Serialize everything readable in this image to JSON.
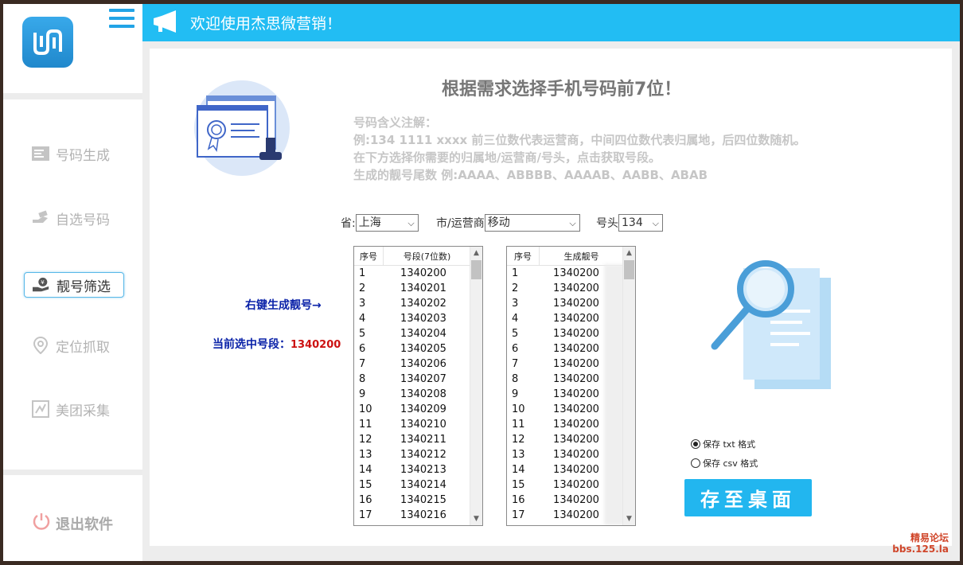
{
  "header": {
    "title": "欢迎使用杰思微营销！"
  },
  "sidebar": {
    "items": [
      {
        "label": "号码生成",
        "icon": "list-icon"
      },
      {
        "label": "自选号码",
        "icon": "hand-icon"
      },
      {
        "label": "靓号筛选",
        "icon": "money-hand-icon"
      },
      {
        "label": "定位抓取",
        "icon": "location-pin-icon"
      },
      {
        "label": "美团采集",
        "icon": "collect-icon"
      }
    ],
    "active_index": 2,
    "exit_label": "退出软件"
  },
  "main": {
    "heading": "根据需求选择手机号码前7位！",
    "notes": [
      "号码含义注解：",
      "例:134 1111 xxxx  前三位数代表运营商，中间四位数代表归属地，后四位数随机。",
      "在下方选择你需要的归属地/运营商/号头，点击获取号段。",
      "生成的靓号尾数 例:AAAA、ABBBB、AAAAB、AABB、ABAB"
    ],
    "filters": {
      "province_label": "省:",
      "province_value": "上海",
      "city_label": "市/运营商",
      "city_value": "移动",
      "prefix_label": "号头",
      "prefix_value": "134"
    },
    "hint_label": "右键生成靓号→",
    "current_label": "当前选中号段：",
    "current_value": "1340200",
    "segment_table": {
      "headers": [
        "序号",
        "号段(7位数)"
      ],
      "rows": [
        [
          "1",
          "1340200"
        ],
        [
          "2",
          "1340201"
        ],
        [
          "3",
          "1340202"
        ],
        [
          "4",
          "1340203"
        ],
        [
          "5",
          "1340204"
        ],
        [
          "6",
          "1340205"
        ],
        [
          "7",
          "1340206"
        ],
        [
          "8",
          "1340207"
        ],
        [
          "9",
          "1340208"
        ],
        [
          "10",
          "1340209"
        ],
        [
          "11",
          "1340210"
        ],
        [
          "12",
          "1340211"
        ],
        [
          "13",
          "1340212"
        ],
        [
          "14",
          "1340213"
        ],
        [
          "15",
          "1340214"
        ],
        [
          "16",
          "1340215"
        ],
        [
          "17",
          "1340216"
        ]
      ]
    },
    "result_table": {
      "headers": [
        "序号",
        "生成靓号"
      ],
      "rows": [
        [
          "1",
          "1340200"
        ],
        [
          "2",
          "1340200"
        ],
        [
          "3",
          "1340200"
        ],
        [
          "4",
          "1340200"
        ],
        [
          "5",
          "1340200"
        ],
        [
          "6",
          "1340200"
        ],
        [
          "7",
          "1340200"
        ],
        [
          "8",
          "1340200"
        ],
        [
          "9",
          "1340200"
        ],
        [
          "10",
          "1340200"
        ],
        [
          "11",
          "1340200"
        ],
        [
          "12",
          "1340200"
        ],
        [
          "13",
          "1340200"
        ],
        [
          "14",
          "1340200"
        ],
        [
          "15",
          "1340200"
        ],
        [
          "16",
          "1340200"
        ],
        [
          "17",
          "1340200"
        ]
      ]
    },
    "save_options": {
      "txt": "保存 txt 格式",
      "csv": "保存 csv 格式",
      "selected": "txt"
    },
    "save_button": "存至桌面"
  },
  "watermark": {
    "line1": "精易论坛",
    "line2": "bbs.125.la"
  },
  "colors": {
    "accent": "#22bdf3",
    "button": "#22b6ef",
    "label_blue": "#0a22a8",
    "label_red": "#cc1111"
  }
}
